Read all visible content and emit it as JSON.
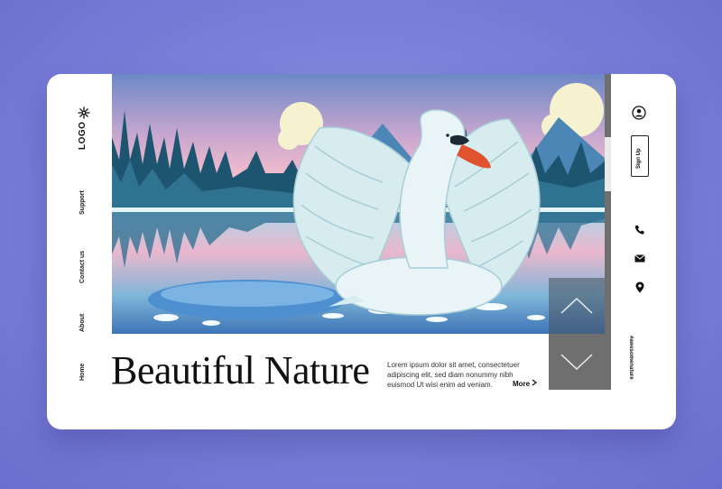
{
  "brand": {
    "logo_text": "LOGO"
  },
  "nav": {
    "items": [
      {
        "label": "Home"
      },
      {
        "label": "About"
      },
      {
        "label": "Contact us"
      },
      {
        "label": "Support"
      }
    ]
  },
  "hero": {
    "headline": "Beautiful Nature",
    "body": "Lorem ipsum dolor sit amet, consectetuer adipiscing elit, sed diam nonummy nibh euismod Ut wisi enim ad veniam.",
    "more_label": "More"
  },
  "account": {
    "signup_label": "Sign Up"
  },
  "social": {
    "handle": "#awesomenature"
  },
  "colors": {
    "background": "#7b82d9",
    "card": "#ffffff",
    "lake": "#7bc0dc",
    "sky_pink": "#f2b9c8",
    "swan": "#e8f4f6",
    "beak": "#e0532e",
    "nav_panel": "#6f6f6f"
  },
  "icons": [
    "snowflake-icon",
    "user-icon",
    "phone-icon",
    "mail-icon",
    "location-icon",
    "chevron-up-icon",
    "chevron-down-icon",
    "chevron-right-icon"
  ]
}
